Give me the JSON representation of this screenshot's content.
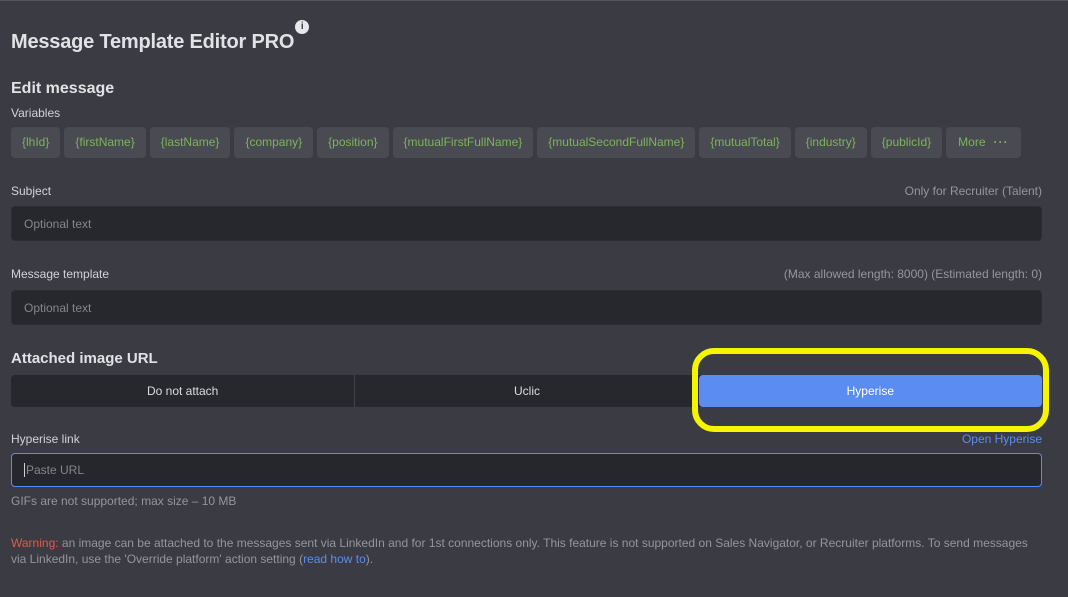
{
  "header": {
    "title": "Message Template Editor PRO",
    "info_icon": "info-icon"
  },
  "edit": {
    "title": "Edit message",
    "variables_label": "Variables",
    "variables": [
      "{lhId}",
      "{firstName}",
      "{lastName}",
      "{company}",
      "{position}",
      "{mutualFirstFullName}",
      "{mutualSecondFullName}",
      "{mutualTotal}",
      "{industry}",
      "{publicId}"
    ],
    "more_label": "More",
    "more_icon": "more-dots-icon"
  },
  "subject": {
    "label": "Subject",
    "hint": "Only for Recruiter (Talent)",
    "placeholder": "Optional text"
  },
  "message": {
    "label": "Message template",
    "hint": "(Max allowed length: 8000) (Estimated length: 0)",
    "placeholder": "Optional text"
  },
  "attach": {
    "title": "Attached image URL",
    "options": [
      "Do not attach",
      "Uclic",
      "Hyperise"
    ],
    "selected": "Hyperise",
    "accent": "#5a8cf2",
    "highlight_color": "#f5f500"
  },
  "hyperise": {
    "label": "Hyperise link",
    "open_link": "Open Hyperise",
    "placeholder": "Paste URL",
    "note": "GIFs are not supported; max size – 10 MB"
  },
  "warning": {
    "prefix": "Warning:",
    "text": " an image can be attached to the messages sent via LinkedIn and for 1st connections only. This feature is not supported on Sales Navigator, or Recruiter platforms. To send messages via LinkedIn, use the 'Override platform' action setting (",
    "link": "read how to",
    "suffix": ")."
  }
}
